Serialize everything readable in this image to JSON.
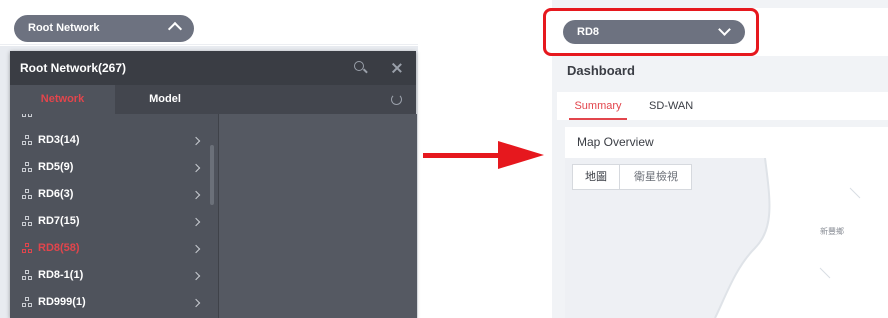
{
  "left": {
    "selector_label": "Root Network",
    "panel_title": "Root Network(267)",
    "tabs": [
      "Network",
      "Model"
    ],
    "items": [
      {
        "label": "RD3(14)",
        "active": false
      },
      {
        "label": "RD5(9)",
        "active": false
      },
      {
        "label": "RD6(3)",
        "active": false
      },
      {
        "label": "RD7(15)",
        "active": false
      },
      {
        "label": "RD8(58)",
        "active": true
      },
      {
        "label": "RD8-1(1)",
        "active": false
      },
      {
        "label": "RD999(1)",
        "active": false
      }
    ]
  },
  "right": {
    "selector_label": "RD8",
    "page_title": "Dashboard",
    "tabs": [
      "Summary",
      "SD-WAN"
    ],
    "card_title": "Map Overview",
    "map_tabs": [
      "地圖",
      "衛星檢視"
    ],
    "map_place_label": "新豐鄉"
  },
  "colors": {
    "accent": "#e2454c",
    "arrow": "#e6181e",
    "pill": "#6d7280",
    "panel": "#4f535c"
  }
}
